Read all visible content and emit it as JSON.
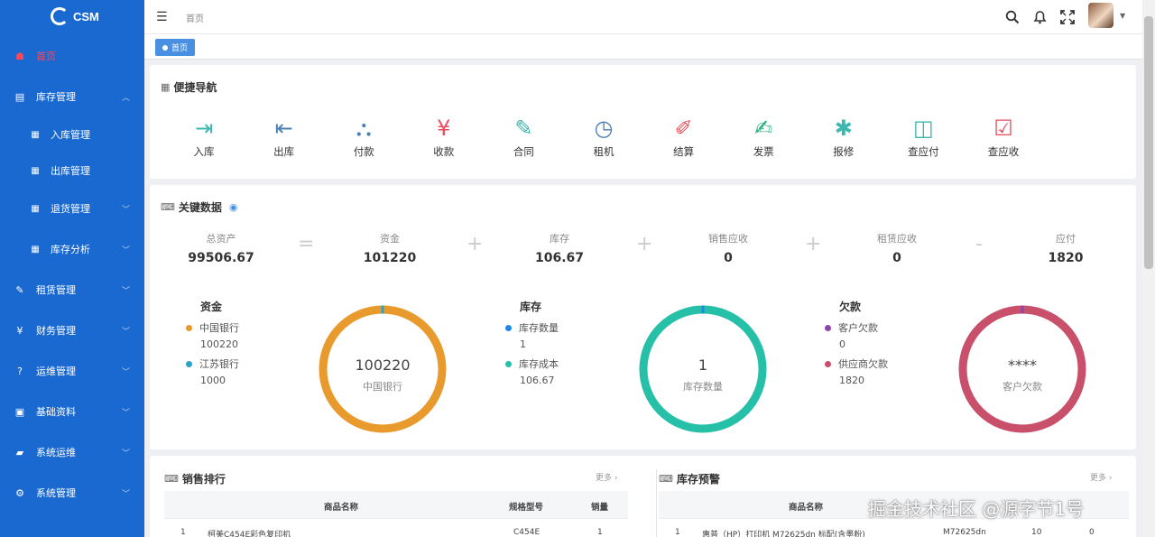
{
  "app": {
    "brand": "CSM"
  },
  "sidebar": {
    "items": [
      {
        "label": "首页",
        "icon": "home-icon"
      },
      {
        "label": "库存管理",
        "icon": "clipboard-icon"
      },
      {
        "label": "入库管理",
        "icon": "grid-icon"
      },
      {
        "label": "出库管理",
        "icon": "grid-icon"
      },
      {
        "label": "退货管理",
        "icon": "grid-icon"
      },
      {
        "label": "库存分析",
        "icon": "grid-icon"
      },
      {
        "label": "租赁管理",
        "icon": "edit-icon"
      },
      {
        "label": "财务管理",
        "icon": "yen-icon"
      },
      {
        "label": "运维管理",
        "icon": "question-icon"
      },
      {
        "label": "基础资料",
        "icon": "document-icon"
      },
      {
        "label": "系统运维",
        "icon": "folder-icon"
      },
      {
        "label": "系统管理",
        "icon": "gear-icon"
      }
    ]
  },
  "header": {
    "breadcrumb": "首页"
  },
  "tabs": [
    {
      "label": "首页"
    }
  ],
  "quick_nav": {
    "title": "便捷导航",
    "items": [
      {
        "label": "入库",
        "icon": "import-icon",
        "color": "#3bb8b0"
      },
      {
        "label": "出库",
        "icon": "export-icon",
        "color": "#4a7fb5"
      },
      {
        "label": "付款",
        "icon": "flow-icon",
        "color": "#4a7fb5"
      },
      {
        "label": "收款",
        "icon": "yen-icon",
        "color": "#e84e5b"
      },
      {
        "label": "合同",
        "icon": "contract-icon",
        "color": "#3bb8b0"
      },
      {
        "label": "租机",
        "icon": "rental-icon",
        "color": "#4a7fb5"
      },
      {
        "label": "结算",
        "icon": "settle-icon",
        "color": "#e84e5b"
      },
      {
        "label": "发票",
        "icon": "invoice-icon",
        "color": "#1fae7a"
      },
      {
        "label": "报修",
        "icon": "bug-icon",
        "color": "#3bb8b0"
      },
      {
        "label": "查应付",
        "icon": "monitor-icon",
        "color": "#3bb8b0"
      },
      {
        "label": "查应收",
        "icon": "receivable-icon",
        "color": "#e84e5b"
      }
    ]
  },
  "key_data": {
    "title": "关键数据",
    "metrics": [
      {
        "label": "总资产",
        "value": "99506.67"
      },
      {
        "label": "资金",
        "value": "101220"
      },
      {
        "label": "库存",
        "value": "106.67"
      },
      {
        "label": "销售应收",
        "value": "0"
      },
      {
        "label": "租赁应收",
        "value": "0"
      },
      {
        "label": "应付",
        "value": "1820"
      }
    ],
    "operators": [
      "=",
      "+",
      "+",
      "+",
      "-"
    ],
    "panels": [
      {
        "title": "资金",
        "legend": [
          {
            "name": "中国银行",
            "value": "100220",
            "color": "#e89a2c"
          },
          {
            "name": "江苏银行",
            "value": "1000",
            "color": "#2ba3c8"
          }
        ],
        "center_value": "100220",
        "center_label": "中国银行",
        "ring_color": "#e89a2c",
        "accent_color": "#2ba3c8"
      },
      {
        "title": "库存",
        "legend": [
          {
            "name": "库存数量",
            "value": "1",
            "color": "#1e88e5"
          },
          {
            "name": "库存成本",
            "value": "106.67",
            "color": "#26c0a8"
          }
        ],
        "center_value": "1",
        "center_label": "库存数量",
        "ring_color": "#26c0a8",
        "accent_color": "#1e88e5"
      },
      {
        "title": "欠款",
        "legend": [
          {
            "name": "客户欠款",
            "value": "0",
            "color": "#8e44ad"
          },
          {
            "name": "供应商欠款",
            "value": "1820",
            "color": "#c8506b"
          }
        ],
        "center_value": "****",
        "center_label": "客户欠款",
        "ring_color": "#c8506b",
        "accent_color": "#8e44ad"
      }
    ]
  },
  "sales_rank": {
    "title": "销售排行",
    "more": "更多",
    "columns": [
      "商品名称",
      "规格型号",
      "销量"
    ],
    "rows": [
      {
        "idx": "1",
        "name": "柯美C454E彩色复印机",
        "model": "C454E",
        "qty": "1"
      }
    ]
  },
  "stock_alert": {
    "title": "库存预警",
    "more": "更多",
    "columns": [
      "商品名称"
    ],
    "rows": [
      {
        "idx": "1",
        "name": "惠普（HP）打印机 M72625dn 标配(含墨粉)",
        "model": "M72625dn",
        "a": "10",
        "b": "0"
      }
    ]
  },
  "watermark": "掘金技术社区 @源字节1号"
}
